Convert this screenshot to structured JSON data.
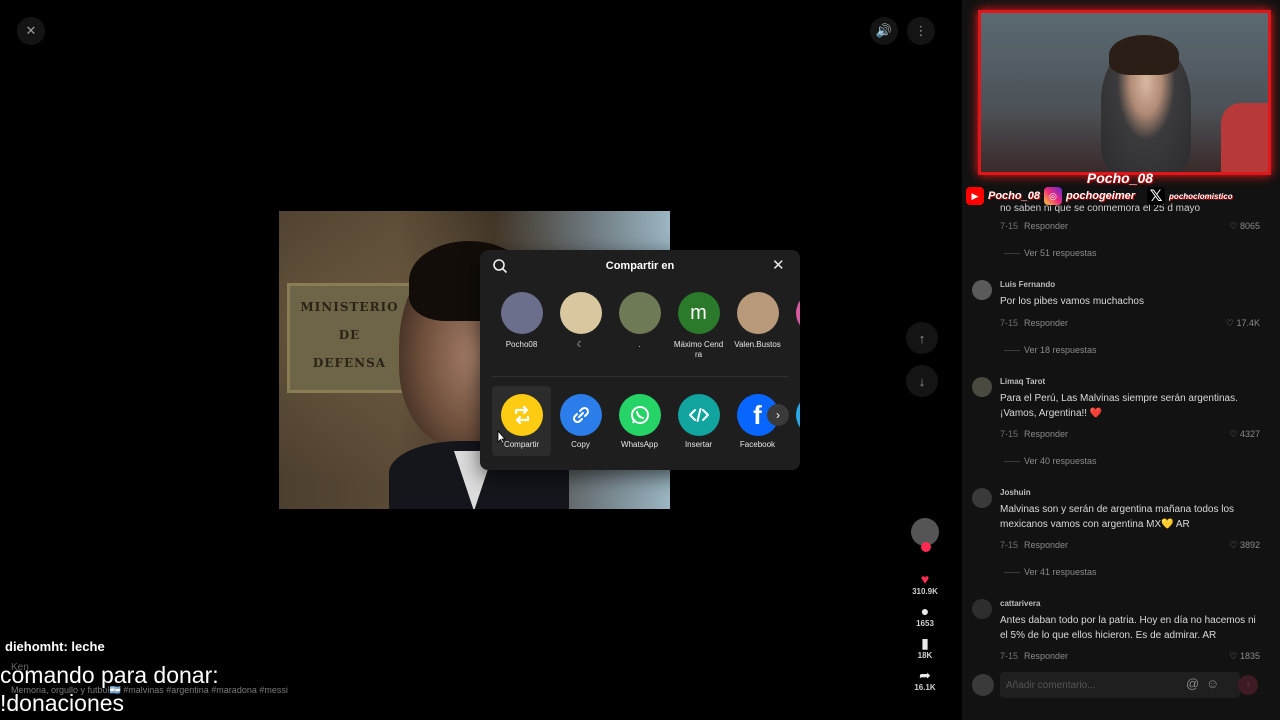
{
  "topbar": {
    "close": "✕",
    "volume": "🔊",
    "more": "⋮"
  },
  "video": {
    "plaque_lines": [
      "MINISTERIO",
      "DE",
      "DEFENSA"
    ]
  },
  "actions": {
    "likes": "310.9K",
    "comments": "1653",
    "saves": "18K",
    "shares": "16.1K"
  },
  "caption": {
    "chat_user": "diehomht: leche",
    "author": "Ken",
    "description": "Memoria, orgullo y futbol🇦🇷 #malvinas #argentina #maradona #messi",
    "donate_line1": "comando para donar:",
    "donate_line2": "!donaciones"
  },
  "share_dialog": {
    "title": "Compartir en",
    "contacts": [
      {
        "name": "Pocho08",
        "color": "#6b6f8c"
      },
      {
        "name": "☾",
        "color": "#d9c7a0"
      },
      {
        "name": ".",
        "color": "#6d7a55"
      },
      {
        "name": "Máximo Cendra",
        "initial": "m",
        "color": "#2b7a2b"
      },
      {
        "name": "Valen.Bustos",
        "color": "#b89a7a"
      },
      {
        "name": "",
        "color": "#d85aa0"
      }
    ],
    "apps": [
      {
        "name": "Compartir",
        "icon": "repost-icon",
        "color": "#fdcc12"
      },
      {
        "name": "Copy",
        "icon": "link-icon",
        "color": "#2b7de9"
      },
      {
        "name": "WhatsApp",
        "icon": "whatsapp-icon",
        "color": "#25d366"
      },
      {
        "name": "Insertar",
        "icon": "embed-icon",
        "color": "#12a5a0"
      },
      {
        "name": "Facebook",
        "icon": "facebook-icon",
        "color": "#0866ff"
      },
      {
        "name": "Te",
        "icon": "telegram-icon",
        "color": "#28a8e9"
      }
    ]
  },
  "stream_overlay": {
    "streamer_name": "Pocho_08",
    "youtube": "Pocho_08",
    "instagram": "pochogeimer",
    "x": "pochoclomistico"
  },
  "comments": {
    "partial_text": "no saben ni que se conmemora el 25 d mayo",
    "partial_date": "7-15",
    "partial_reply": "Responder",
    "partial_likes": "8065",
    "partial_replies": "Ver 51 respuestas",
    "items": [
      {
        "user": "Luis Fernando",
        "text": "Por los pibes vamos muchachos",
        "date": "7-15",
        "reply": "Responder",
        "likes": "17.4K",
        "replies": "Ver 18 respuestas",
        "avatar_color": "#5a5a5a"
      },
      {
        "user": "Limaq Tarot",
        "text": "Para el Perú, Las Malvinas siempre serán argentinas. ¡Vamos, Argentina!! ❤️",
        "date": "7-15",
        "reply": "Responder",
        "likes": "4327",
        "replies": "Ver 40 respuestas",
        "avatar_color": "#4a4a40"
      },
      {
        "user": "Joshuin",
        "text": "Malvinas son y serán de argentina mañana todos los mexicanos vamos con argentina MX💛 AR",
        "date": "7-15",
        "reply": "Responder",
        "likes": "3892",
        "replies": "Ver 41 respuestas",
        "avatar_color": "#3a3a3a"
      },
      {
        "user": "cattarivera",
        "text": "Antes daban todo por la patria. Hoy en día no hacemos ni el 5% de lo que ellos hicieron. Es de admirar. AR",
        "date": "7-15",
        "reply": "Responder",
        "likes": "1835",
        "replies": "",
        "avatar_color": "#2e2e2e"
      }
    ],
    "input_placeholder": "Añadir comentario..."
  }
}
